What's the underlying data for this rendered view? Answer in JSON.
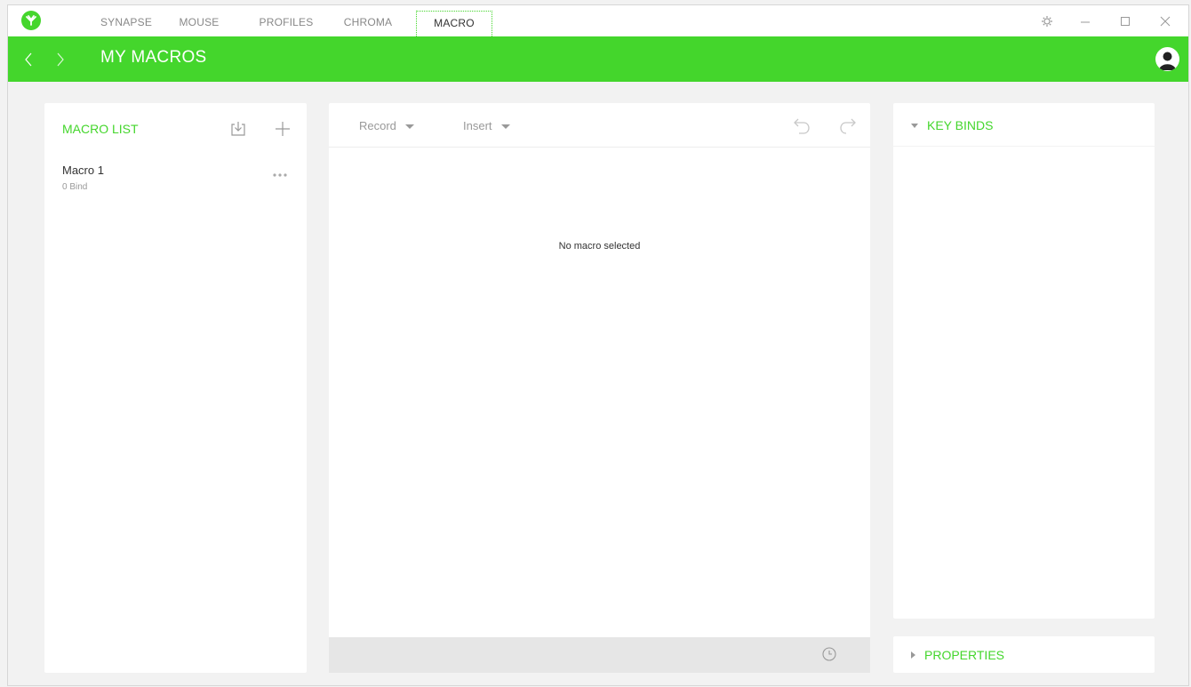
{
  "titlebar": {
    "tabs": [
      {
        "label": "SYNAPSE"
      },
      {
        "label": "MOUSE"
      },
      {
        "label": "PROFILES"
      },
      {
        "label": "CHROMA"
      },
      {
        "label": "MACRO"
      }
    ],
    "active_tab": "MACRO"
  },
  "header": {
    "title": "MY MACROS"
  },
  "macro_list": {
    "title": "MACRO LIST",
    "items": [
      {
        "name": "Macro 1",
        "binds": "0 Bind"
      }
    ]
  },
  "editor": {
    "record_label": "Record",
    "insert_label": "Insert",
    "empty_message": "No macro selected"
  },
  "keybinds": {
    "title": "KEY BINDS"
  },
  "properties": {
    "title": "PROPERTIES"
  },
  "colors": {
    "accent": "#44d62c",
    "background": "#f2f2f2",
    "panel": "#ffffff",
    "muted_text": "#999999"
  },
  "icons": {
    "logo": "razer-logo-icon",
    "settings": "gear-icon",
    "minimize": "minimize-icon",
    "maximize": "maximize-icon",
    "close": "close-icon",
    "back": "chevron-left-icon",
    "forward": "chevron-right-icon",
    "account": "user-avatar-icon",
    "import": "import-icon",
    "add": "plus-icon",
    "more": "more-dots-icon",
    "undo": "undo-icon",
    "redo": "redo-icon",
    "delay": "clock-icon"
  }
}
